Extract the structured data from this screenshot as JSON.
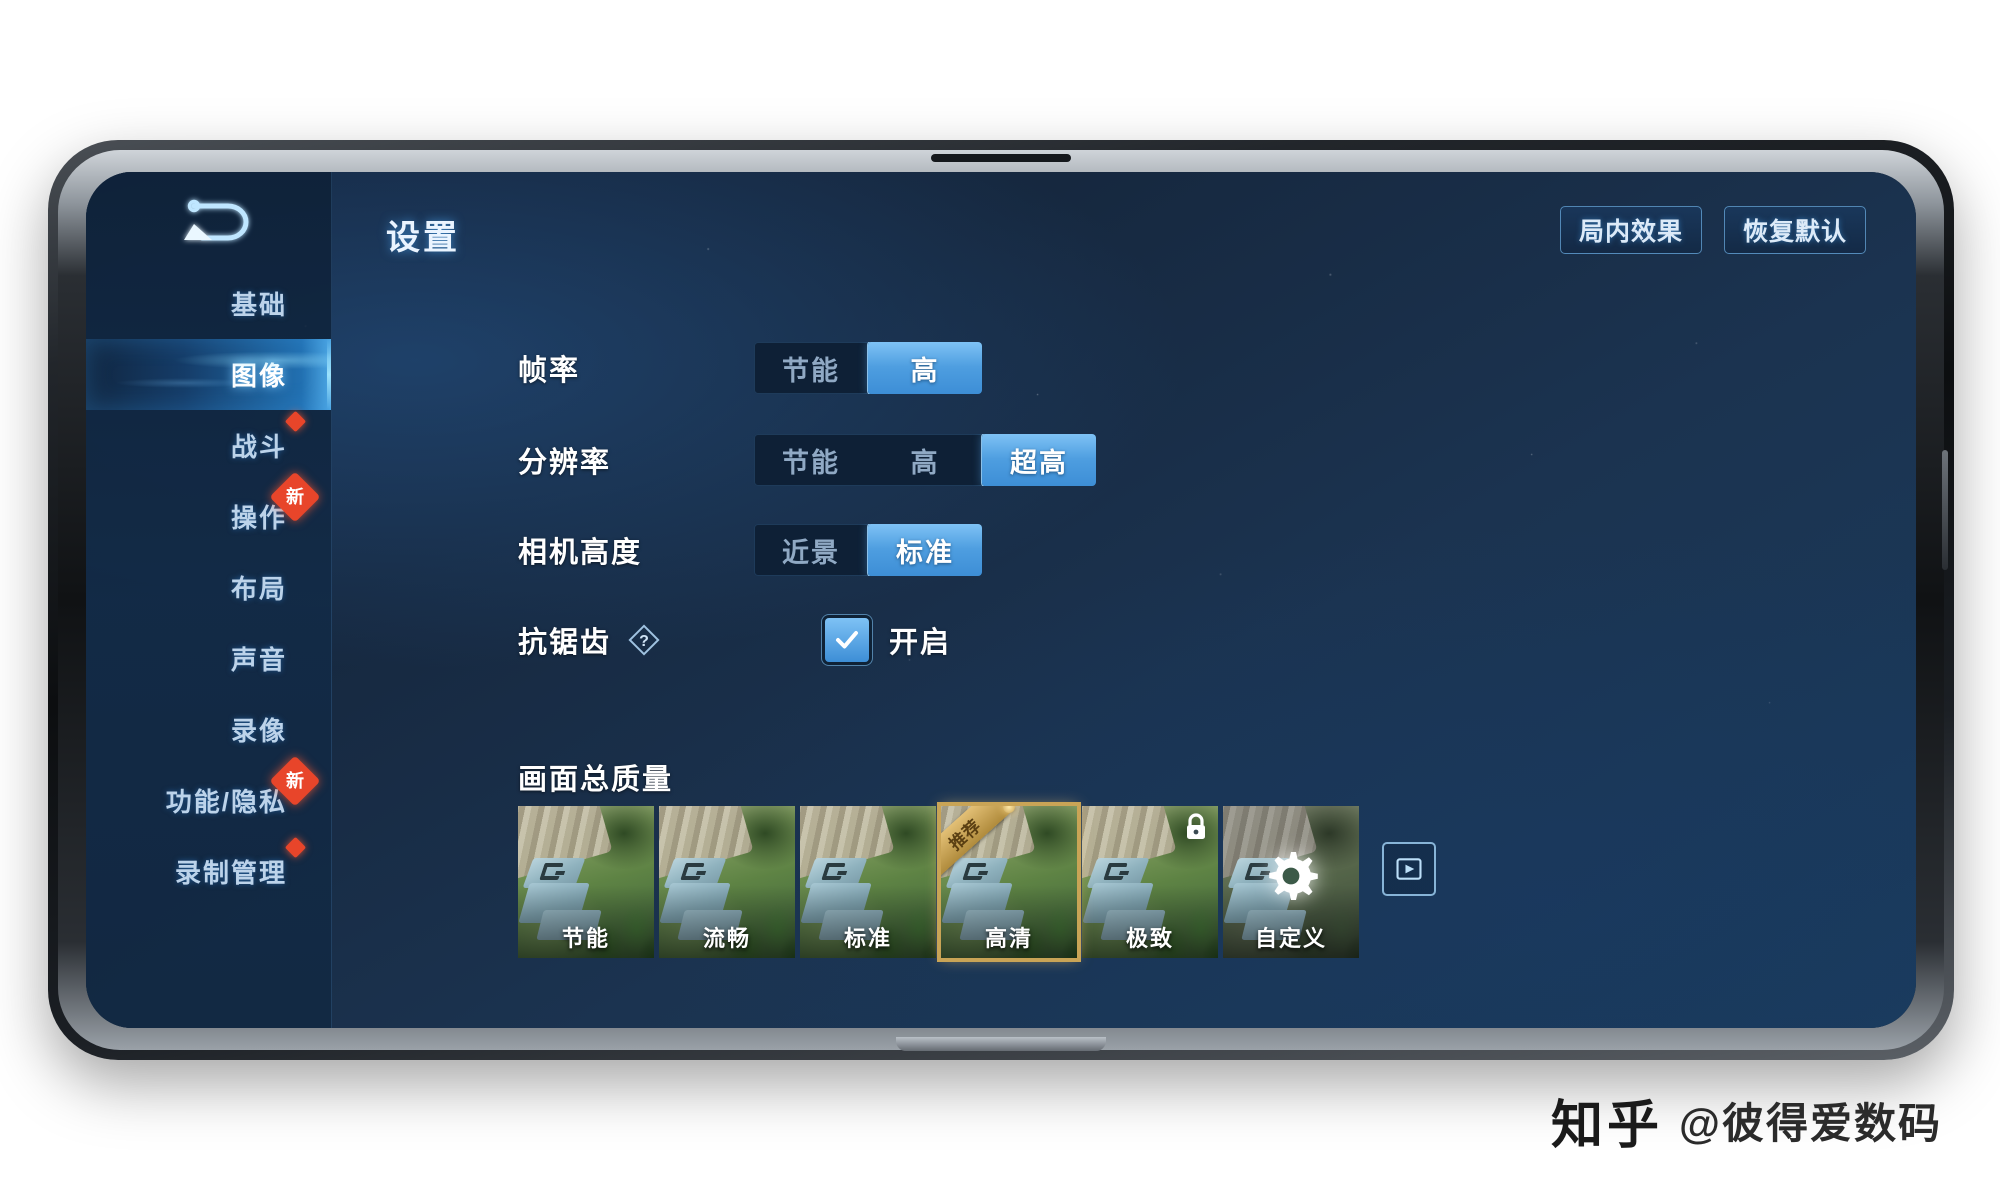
{
  "header": {
    "title": "设置",
    "back_icon": "back-arrow-icon",
    "actions": [
      {
        "label": "局内效果"
      },
      {
        "label": "恢复默认"
      }
    ]
  },
  "sidebar": {
    "items": [
      {
        "label": "基础",
        "active": false,
        "badge": "none"
      },
      {
        "label": "图像",
        "active": true,
        "badge": "none"
      },
      {
        "label": "战斗",
        "active": false,
        "badge": "dot"
      },
      {
        "label": "操作",
        "active": false,
        "badge": "new",
        "badge_text": "新"
      },
      {
        "label": "布局",
        "active": false,
        "badge": "none"
      },
      {
        "label": "声音",
        "active": false,
        "badge": "none"
      },
      {
        "label": "录像",
        "active": false,
        "badge": "none"
      },
      {
        "label": "功能/隐私",
        "active": false,
        "badge": "new",
        "badge_text": "新"
      },
      {
        "label": "录制管理",
        "active": false,
        "badge": "dot"
      }
    ]
  },
  "settings": {
    "rows": [
      {
        "label": "帧率",
        "type": "segmented",
        "options": [
          {
            "label": "节能",
            "selected": false
          },
          {
            "label": "高",
            "selected": true
          }
        ]
      },
      {
        "label": "分辨率",
        "type": "segmented",
        "options": [
          {
            "label": "节能",
            "selected": false
          },
          {
            "label": "高",
            "selected": false
          },
          {
            "label": "超高",
            "selected": true
          }
        ]
      },
      {
        "label": "相机高度",
        "type": "segmented",
        "options": [
          {
            "label": "近景",
            "selected": false
          },
          {
            "label": "标准",
            "selected": true
          }
        ]
      },
      {
        "label": "抗锯齿",
        "type": "checkbox",
        "help_icon": "question-diamond-icon",
        "checkbox": {
          "checked": true,
          "label": "开启"
        }
      }
    ]
  },
  "quality": {
    "title": "画面总质量",
    "presets": [
      {
        "label": "节能",
        "selected": false,
        "locked": false,
        "ribbon": "",
        "icon": "none"
      },
      {
        "label": "流畅",
        "selected": false,
        "locked": false,
        "ribbon": "",
        "icon": "none"
      },
      {
        "label": "标准",
        "selected": false,
        "locked": false,
        "ribbon": "",
        "icon": "none"
      },
      {
        "label": "高清",
        "selected": true,
        "locked": false,
        "ribbon": "推荐",
        "icon": "none"
      },
      {
        "label": "极致",
        "selected": false,
        "locked": true,
        "ribbon": "",
        "icon": "lock-icon"
      },
      {
        "label": "自定义",
        "selected": false,
        "locked": false,
        "ribbon": "",
        "icon": "gear-icon"
      }
    ],
    "preview_button_icon": "video-preview-icon"
  },
  "watermark": {
    "logo": "知乎",
    "name": "@彼得爱数码"
  },
  "colors": {
    "accent_blue": "#4e9ee0",
    "accent_blue_light": "#7ec2f5",
    "panel_dark": "#0e2036",
    "badge_red": "#e8452a",
    "gold": "#c9a456"
  }
}
